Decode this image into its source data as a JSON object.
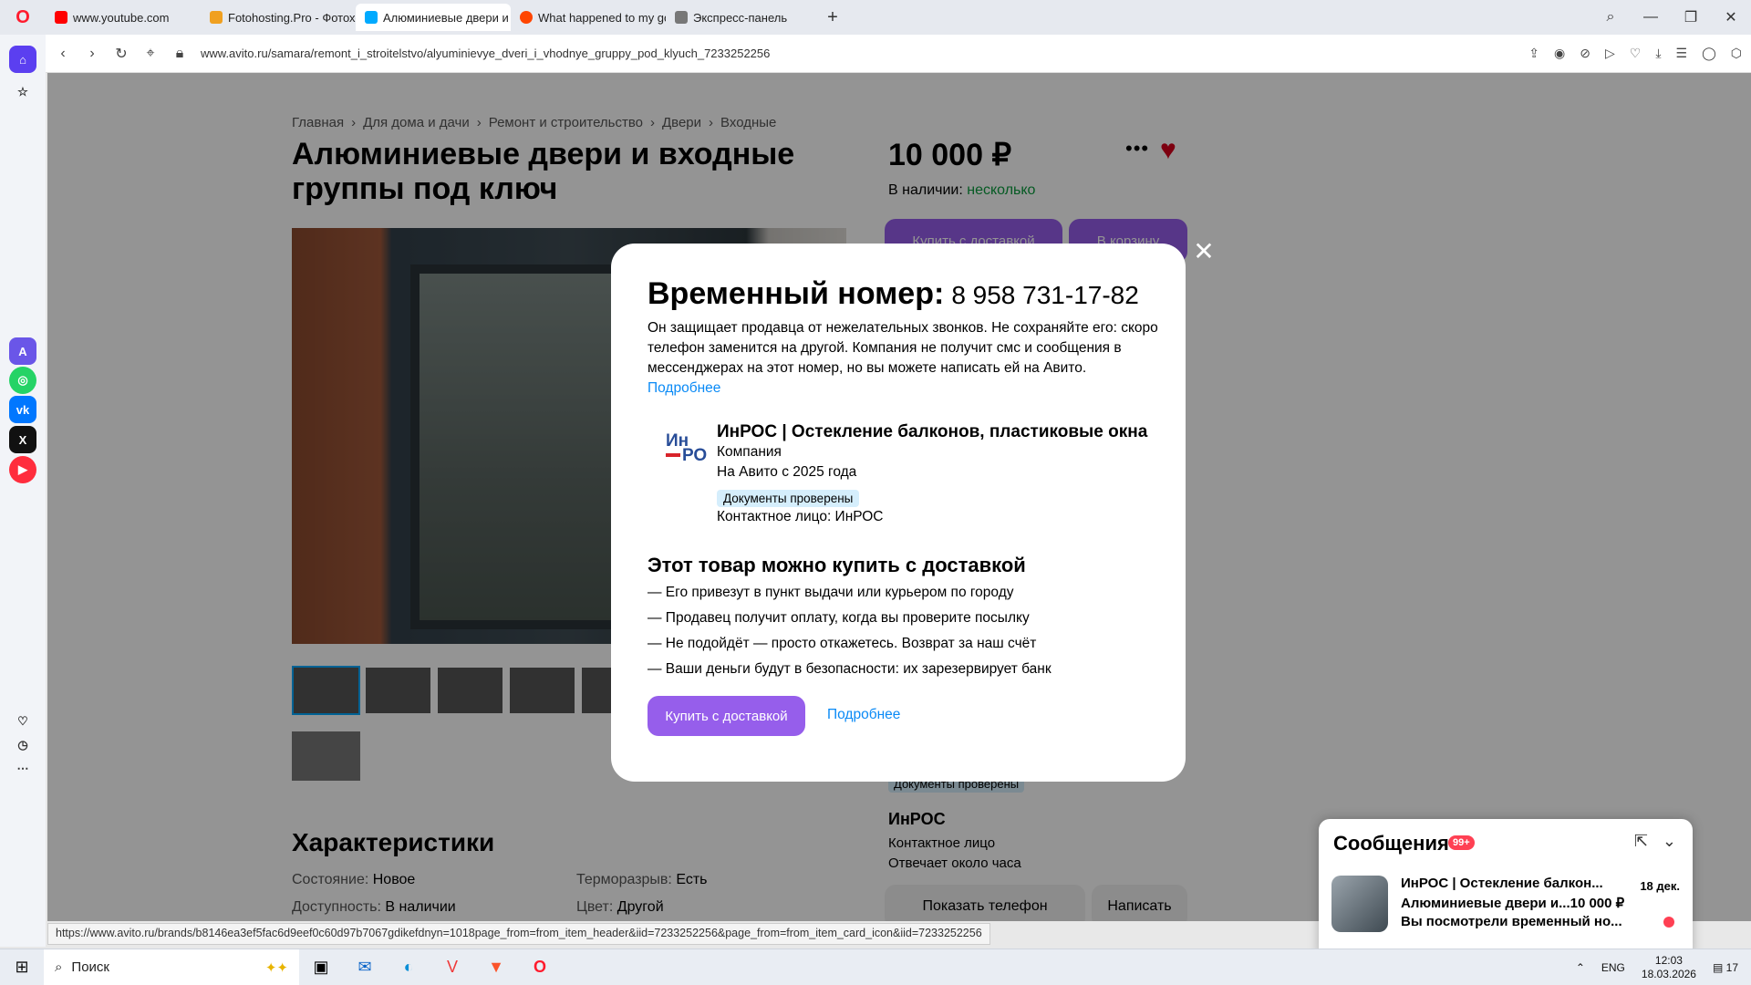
{
  "browser": {
    "tabs": [
      {
        "label": "www.youtube.com",
        "color": "#ff0000"
      },
      {
        "label": "Fotohosting.Pro - Фотохо",
        "color": "#f0a020"
      },
      {
        "label": "Алюминиевые двери и в",
        "color": "#00aaff"
      },
      {
        "label": "What happened to my go",
        "color": "#ff4500"
      },
      {
        "label": "Экспресс-панель",
        "color": "#777777"
      }
    ],
    "url": "www.avito.ru/samara/remont_i_stroitelstvo/alyuminievye_dveri_i_vhodnye_gruppy_pod_klyuch_7233252256",
    "status_url": "https://www.avito.ru/brands/b8146ea3ef5fac6d9eef0c60d97b7067gdikefdnyn=1018page_from=from_item_header&iid=7233252256&page_from=from_item_card_icon&iid=7233252256"
  },
  "listing": {
    "breadcrumbs": [
      "Главная",
      "Для дома и дачи",
      "Ремонт и строительство",
      "Двери",
      "Входные"
    ],
    "title": "Алюминиевые двери и входные группы под ключ",
    "price": "10 000 ₽",
    "stock_label": "В наличии:",
    "stock_value": "несколько",
    "buy_delivery_label": "Купить с доставкой",
    "cart_label": "В корзину",
    "characteristics_title": "Характеристики",
    "characteristics": [
      {
        "label": "Состояние:",
        "value": "Новое"
      },
      {
        "label": "Терморазрыв:",
        "value": "Есть"
      },
      {
        "label": "Доступность:",
        "value": "В наличии"
      },
      {
        "label": "Цвет:",
        "value": "Другой"
      }
    ],
    "seller": {
      "docs_badge": "Документы проверены",
      "name": "ИнРОС",
      "role": "Контактное лицо",
      "response": "Отвечает около часа",
      "show_phone": "Показать телефон",
      "write": "Написать"
    }
  },
  "modal": {
    "title": "Временный номер:",
    "number": "8 958 731-17-82",
    "text": "Он защищает продавца от нежелательных звонков. Не сохраняйте его: скоро телефон заменится на другой. Компания не получит смс и сообщения в мессенджерах на этот номер, но вы можете написать ей на Авито.",
    "text_link": "Подробнее",
    "company_name": "ИнРОС | Остекление балконов, пластиковые окна",
    "company_type": "Компания",
    "company_since": "На Авито с 2025 года",
    "company_badge": "Документы проверены",
    "company_contact": "Контактное лицо: ИнРОС",
    "delivery_title": "Этот товар можно купить с доставкой",
    "delivery_items": [
      "— Его привезут в пункт выдачи или курьером по городу",
      "— Продавец получит оплату, когда вы проверите посылку",
      "— Не подойдёт — просто откажетесь. Возврат за наш счёт",
      "— Ваши деньги будут в безопасности: их зарезервирует банк"
    ],
    "buy_button": "Купить с доставкой",
    "more_link": "Подробнее"
  },
  "messages": {
    "title": "Сообщения",
    "badge": "99+",
    "item_title": "ИнРОС | Остекление балкон...",
    "item_subtitle": "Алюминиевые двери и...10 000 ₽",
    "item_preview": "Вы посмотрели временный но...",
    "item_date": "18 дек."
  },
  "taskbar": {
    "search_placeholder": "Поиск",
    "lang": "ENG",
    "time": "12:03",
    "date": "18.03.2026",
    "notifications": "17"
  }
}
